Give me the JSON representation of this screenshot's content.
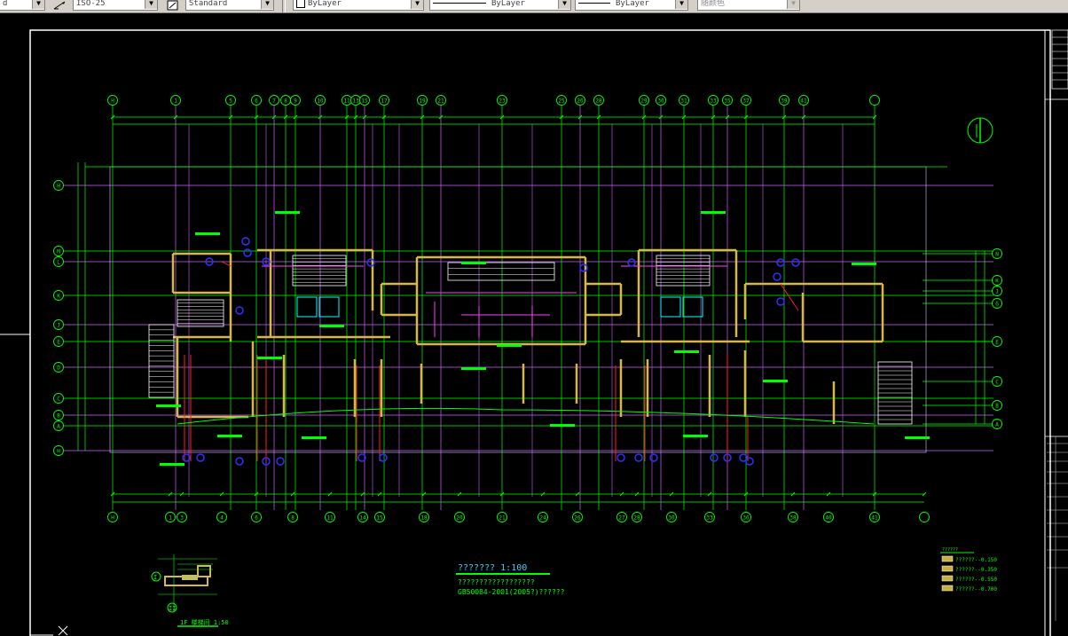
{
  "toolbar": {
    "first_combo": "d",
    "dimstyle": "ISO-25",
    "textstyle": "Standard",
    "color": "ByLayer",
    "linetype": "ByLayer",
    "lineweight": "ByLayer",
    "plotstyle": "随颜色"
  },
  "drawing": {
    "title": "???????  1:100",
    "subtitle": "??????????????????",
    "standard": "GB50084-2001(2005?)??????",
    "detail_caption": "1F 楼梯间 1:50",
    "legend_title": "??????",
    "legend_items": [
      "??????--0.150",
      "??????--0.350",
      "??????--0.550",
      "??????--0.700"
    ]
  },
  "colors": {
    "background": "#000000",
    "axis_green": "#00ff00",
    "wall_yellow": "#d8b74a",
    "grid_magenta": "#d060ff",
    "pipe_red": "#ff2020",
    "equip_blue": "#3030ff",
    "cyan": "#00ffff"
  },
  "axis_bubbles_top": [
    "H",
    "1",
    "5",
    "6",
    "7",
    "8",
    "9",
    "10",
    "11",
    "13",
    "15",
    "17",
    "19",
    "21",
    "23",
    "25",
    "26",
    "28",
    "29",
    "30",
    "31",
    "33",
    "35",
    "37",
    "39",
    "41"
  ],
  "axis_bubbles_bottom": [
    "H",
    "1",
    "3",
    "4",
    "6",
    "8",
    "11",
    "14",
    "15",
    "18",
    "20",
    "21",
    "24",
    "26",
    "27",
    "28",
    "30",
    "33",
    "36",
    "38",
    "40",
    "41"
  ],
  "axis_bubbles_left": [
    "H",
    "M",
    "L",
    "K",
    "J",
    "E",
    "D",
    "C",
    "B",
    "A",
    "H"
  ],
  "axis_bubbles_right": [
    "N",
    "K",
    "J",
    "G",
    "E",
    "C",
    "B",
    "A"
  ]
}
